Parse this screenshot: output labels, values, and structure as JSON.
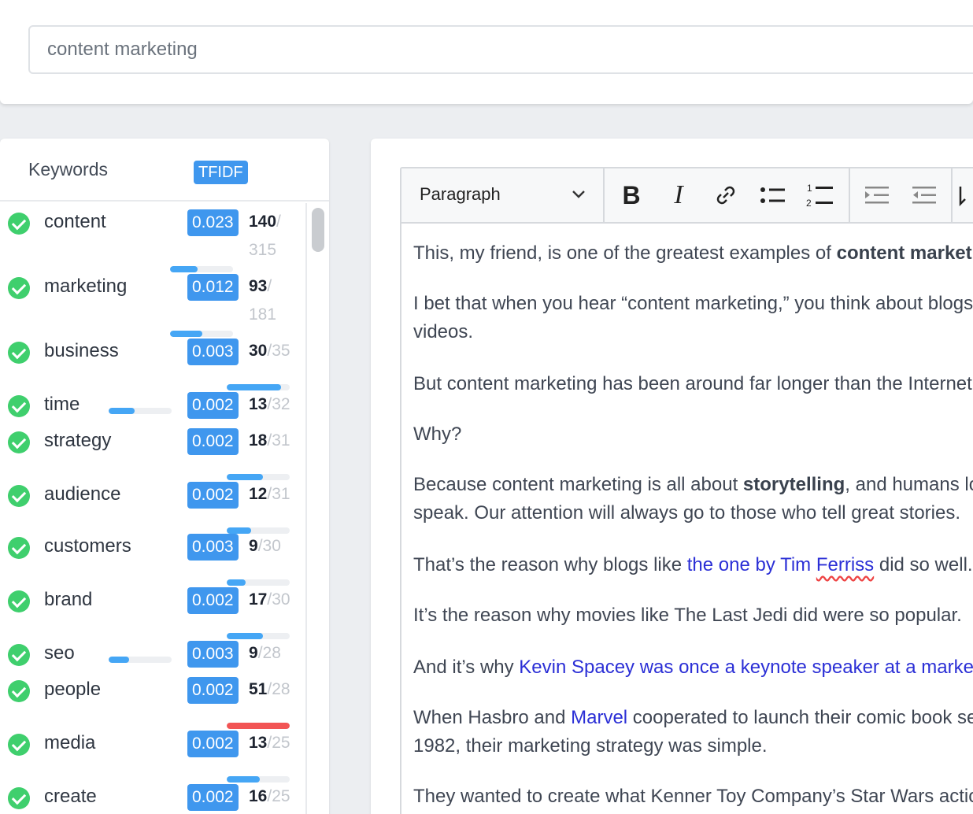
{
  "search": {
    "value": "content marketing"
  },
  "keywords_panel": {
    "title": "Keywords",
    "badge": "TFIDF",
    "items": [
      {
        "word": "content",
        "score": "0.023",
        "current": "140",
        "target": "315",
        "progress": 0.44,
        "over": false
      },
      {
        "word": "marketing",
        "score": "0.012",
        "current": "93",
        "target": "181",
        "progress": 0.51,
        "over": false
      },
      {
        "word": "business",
        "score": "0.003",
        "current": "30",
        "target": "35",
        "progress": 0.86,
        "over": false
      },
      {
        "word": "time",
        "score": "0.002",
        "current": "13",
        "target": "32",
        "progress": 0.41,
        "over": false
      },
      {
        "word": "strategy",
        "score": "0.002",
        "current": "18",
        "target": "31",
        "progress": 0.58,
        "over": false
      },
      {
        "word": "audience",
        "score": "0.002",
        "current": "12",
        "target": "31",
        "progress": 0.39,
        "over": false
      },
      {
        "word": "customers",
        "score": "0.003",
        "current": "9",
        "target": "30",
        "progress": 0.3,
        "over": false
      },
      {
        "word": "brand",
        "score": "0.002",
        "current": "17",
        "target": "30",
        "progress": 0.57,
        "over": false
      },
      {
        "word": "seo",
        "score": "0.003",
        "current": "9",
        "target": "28",
        "progress": 0.32,
        "over": false
      },
      {
        "word": "people",
        "score": "0.002",
        "current": "51",
        "target": "28",
        "progress": 1.0,
        "over": true
      },
      {
        "word": "media",
        "score": "0.002",
        "current": "13",
        "target": "25",
        "progress": 0.52,
        "over": false
      },
      {
        "word": "create",
        "score": "0.002",
        "current": "16",
        "target": "25",
        "progress": 0.64,
        "over": false
      }
    ]
  },
  "editor": {
    "block_format": "Paragraph",
    "toolbar_icons": [
      "bold-icon",
      "italic-icon",
      "link-icon",
      "bulleted-list-icon",
      "numbered-list-icon",
      "indent-icon",
      "outdent-icon"
    ],
    "paragraphs": {
      "p1_a": "This, my friend, is one of the greatest examples of ",
      "p1_b": "content marketing",
      "p2_l1": "I bet that when you hear “content marketing,” you think about blogs and",
      "p2_l2": "videos.",
      "p3": "But content marketing has been around far longer than the Internet.",
      "p4": "Why?",
      "p5_a": "Because content marketing is all about ",
      "p5_b": "storytelling",
      "p5_c": ", and humans love stories.",
      "p5_l2": "speak. Our attention will always go to those who tell great stories.",
      "p6_a": "That’s the reason why blogs like ",
      "p6_link_a": "the one by Tim ",
      "p6_link_b": "Ferriss",
      "p6_c": " did so well.",
      "p7": "It’s the reason why movies like The Last Jedi did were so popular.",
      "p8_a": "And it’s why ",
      "p8_link": "Kevin Spacey was once a keynote speaker at a marketing conference.",
      "p9_a": "When Hasbro and ",
      "p9_link": "Marvel",
      "p9_c": " cooperated to launch their comic book series in",
      "p9_l2": "1982, their marketing strategy was simple.",
      "p10": "They wanted to create what Kenner Toy Company’s Star Wars action figures"
    }
  }
}
